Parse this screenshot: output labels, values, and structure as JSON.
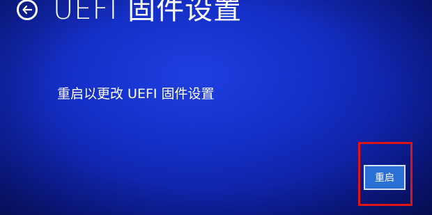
{
  "header": {
    "back_icon": "arrow-left-icon",
    "title": "UEFI 固件设置"
  },
  "main": {
    "description": "重启以更改 UEFI 固件设置",
    "restart_label": "重启"
  },
  "colors": {
    "background": "#1530c8",
    "highlight_border": "#e01414",
    "button_bg": "#2a6fd6"
  }
}
